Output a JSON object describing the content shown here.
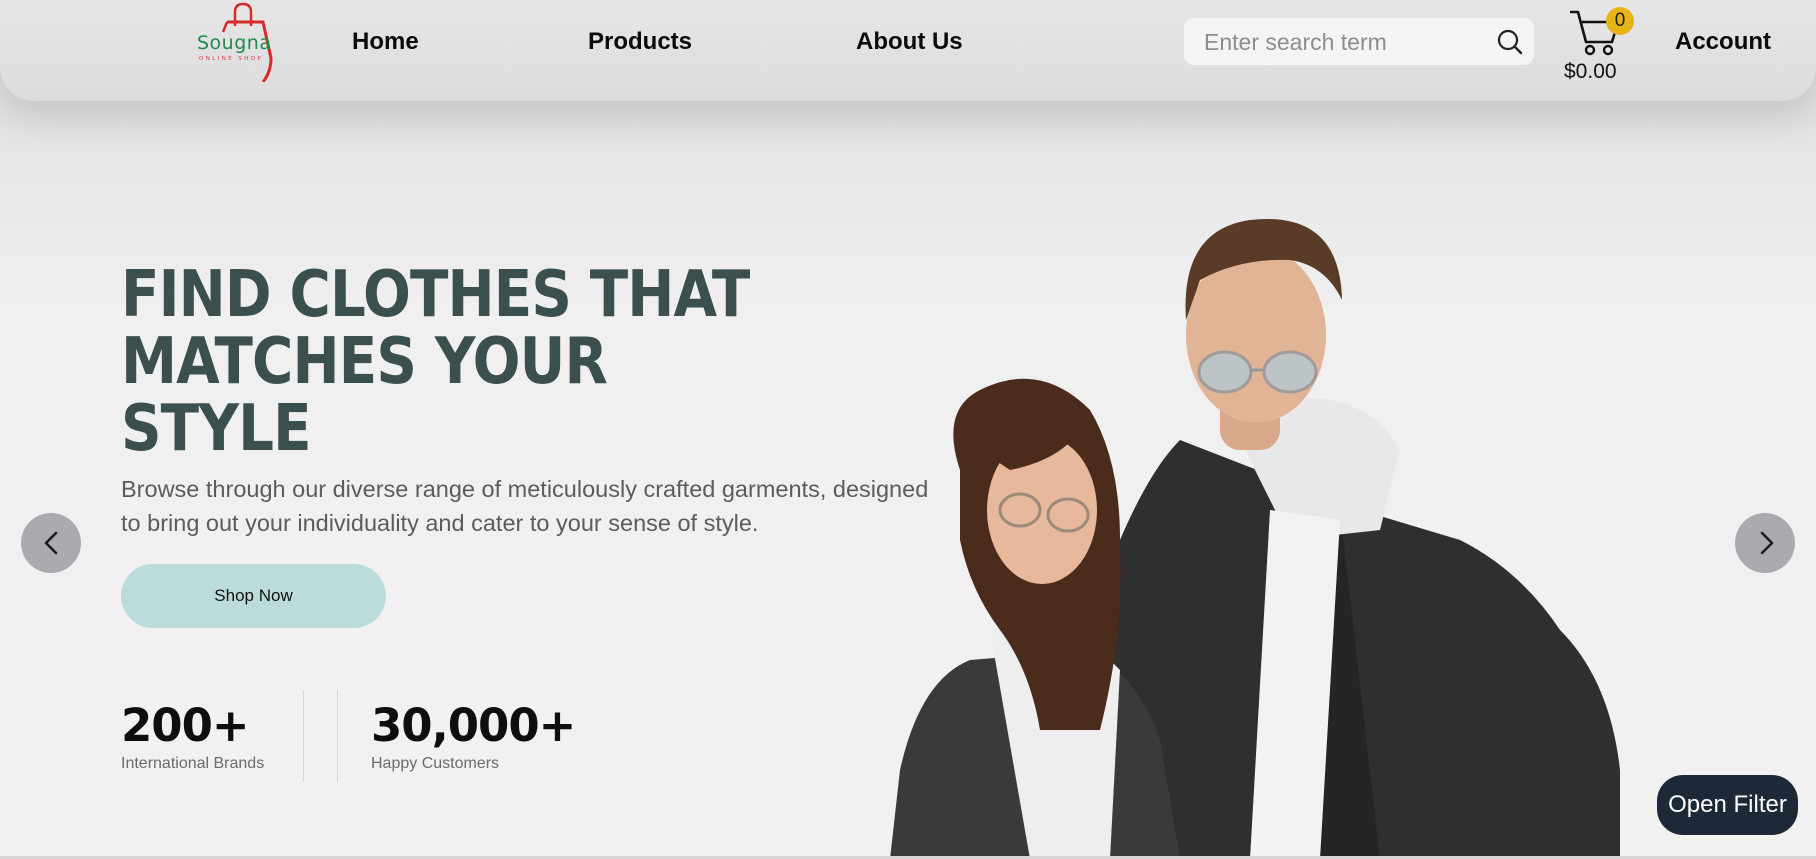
{
  "header": {
    "logo": {
      "name": "Sougna",
      "subtitle": "ONLINE SHOP"
    },
    "nav": [
      {
        "label": "Home"
      },
      {
        "label": "Products"
      },
      {
        "label": "About Us"
      }
    ],
    "search": {
      "placeholder": "Enter search term",
      "value": ""
    },
    "cart": {
      "count": "0",
      "total": "$0.00"
    },
    "account_label": "Account"
  },
  "hero": {
    "title_line1": "FIND CLOTHES THAT",
    "title_line2": "MATCHES YOUR STYLE",
    "description": "Browse through our diverse range of meticulously crafted garments, designed to bring out your individuality and cater to your sense of style.",
    "cta_label": "Shop Now",
    "stats": [
      {
        "value": "200+",
        "label": "International Brands"
      },
      {
        "value": "30,000+",
        "label": "Happy Customers"
      }
    ]
  },
  "filter_button": "Open Filter",
  "colors": {
    "title": "#3c4f4f",
    "cta": "#bcdcdc",
    "badge": "#e7b417",
    "filter_button": "#1e2938"
  },
  "icons": {
    "search": "search-icon",
    "cart": "cart-icon",
    "prev": "chevron-left-icon",
    "next": "chevron-right-icon"
  }
}
